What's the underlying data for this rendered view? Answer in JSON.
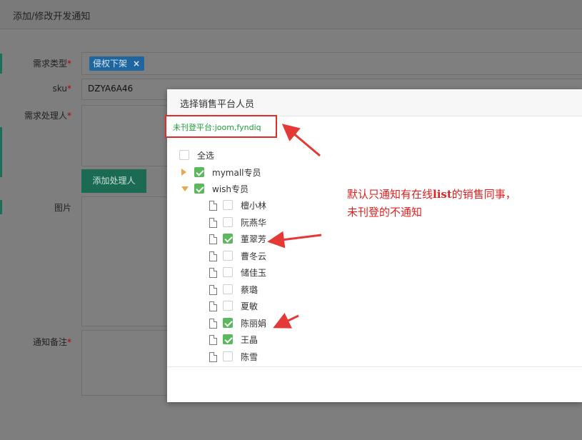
{
  "outer_dialog": {
    "title": "添加/修改开发通知",
    "labels": {
      "demand_type": "需求类型",
      "sku": "sku",
      "handler": "需求处理人",
      "image": "图片",
      "remark": "通知备注",
      "required_mark": "*"
    },
    "demand_type_tag": "侵权下架",
    "tag_close": "×",
    "sku_value": "DZYA6A46",
    "add_handler_button": "添加处理人"
  },
  "modal": {
    "title": "选择销售平台人员",
    "unlisted_platforms": "未刊登平台:joom,fyndiq",
    "select_all": "全选",
    "groups": [
      {
        "label": "mymall专员",
        "checked": true,
        "expanded": false,
        "members": []
      },
      {
        "label": "wish专员",
        "checked": true,
        "expanded": true,
        "members": [
          {
            "name": "檀小林",
            "checked": false
          },
          {
            "name": "阮燕华",
            "checked": false
          },
          {
            "name": "董翠芳",
            "checked": true
          },
          {
            "name": "曹冬云",
            "checked": false
          },
          {
            "name": "储佳玉",
            "checked": false
          },
          {
            "name": "蔡璐",
            "checked": false
          },
          {
            "name": "夏敏",
            "checked": false
          },
          {
            "name": "陈丽娟",
            "checked": true
          },
          {
            "name": "王晶",
            "checked": true
          },
          {
            "name": "陈雪",
            "checked": false
          }
        ]
      }
    ]
  },
  "annotation": {
    "line1_before": "默认只通知有在线",
    "line1_strong": "list",
    "line1_after": "的销售同事，",
    "line2": "未刊登的不通知",
    "color": "#e02020"
  },
  "icons": [
    "caret-right-icon",
    "caret-down-icon",
    "file-icon",
    "checkbox-icon",
    "close-icon"
  ],
  "colors": {
    "checked": "#5cb85c",
    "tag": "#1f66a0",
    "primary_button": "#1b6a54",
    "highlight": "#e02b2b",
    "unlisted_text": "#1f9e3a"
  }
}
